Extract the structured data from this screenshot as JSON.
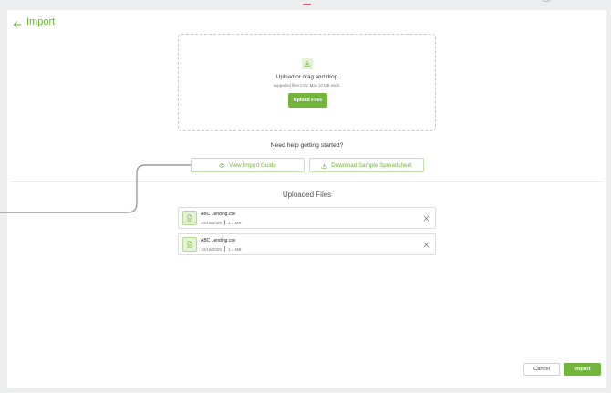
{
  "header": {
    "title": "Import",
    "back_icon": "arrow-left-icon"
  },
  "dropzone": {
    "icon": "download-tray-icon",
    "title": "Upload or drag and drop",
    "subtitle": "supported files CSV. Max 10 MB each.",
    "upload_button": "Upload Files"
  },
  "help": {
    "title": "Need help getting started?",
    "guide_button": "View Import Guide",
    "guide_icon": "eye-icon",
    "download_button": "Download Sample Spreadsheet",
    "download_icon": "download-icon"
  },
  "uploaded": {
    "title": "Uploaded Files",
    "files": [
      {
        "name": "ABC Lending.csv",
        "date": "10/19/2025",
        "size": "1.1 MB"
      },
      {
        "name": "ABC Lending.csv",
        "date": "10/19/2025",
        "size": "1.1 MB"
      }
    ]
  },
  "footer": {
    "cancel_label": "Cancel",
    "import_label": "Import"
  },
  "colors": {
    "accent": "#73b53c",
    "accent_light": "#e4f2d6",
    "border": "#dddddd"
  }
}
